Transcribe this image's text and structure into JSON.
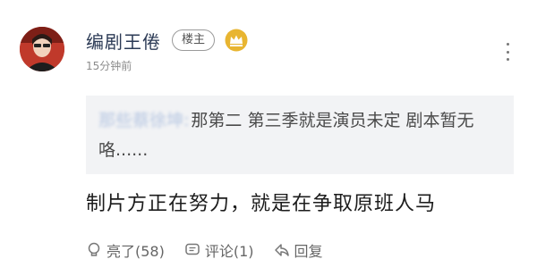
{
  "post": {
    "author_name": "编剧王倦",
    "op_badge": "楼主",
    "time": "15分钟前"
  },
  "quote": {
    "username": "那些蔡徐坤:",
    "text": "那第二 第三季就是演员未定 剧本暂无咯......"
  },
  "reply_text": "制片方正在努力，就是在争取原班人马",
  "actions": {
    "like_label": "亮了(58)",
    "comment_label": "评论(1)",
    "reply_label": "回复"
  },
  "icons": {
    "crown": "crown-icon",
    "more": "more-vertical-icon",
    "like": "lightbulb-icon",
    "comment": "comment-icon",
    "reply": "reply-icon"
  },
  "colors": {
    "author_name": "#2b3a55",
    "crown_gold": "#e8b531",
    "quote_background": "#f2f3f5"
  }
}
